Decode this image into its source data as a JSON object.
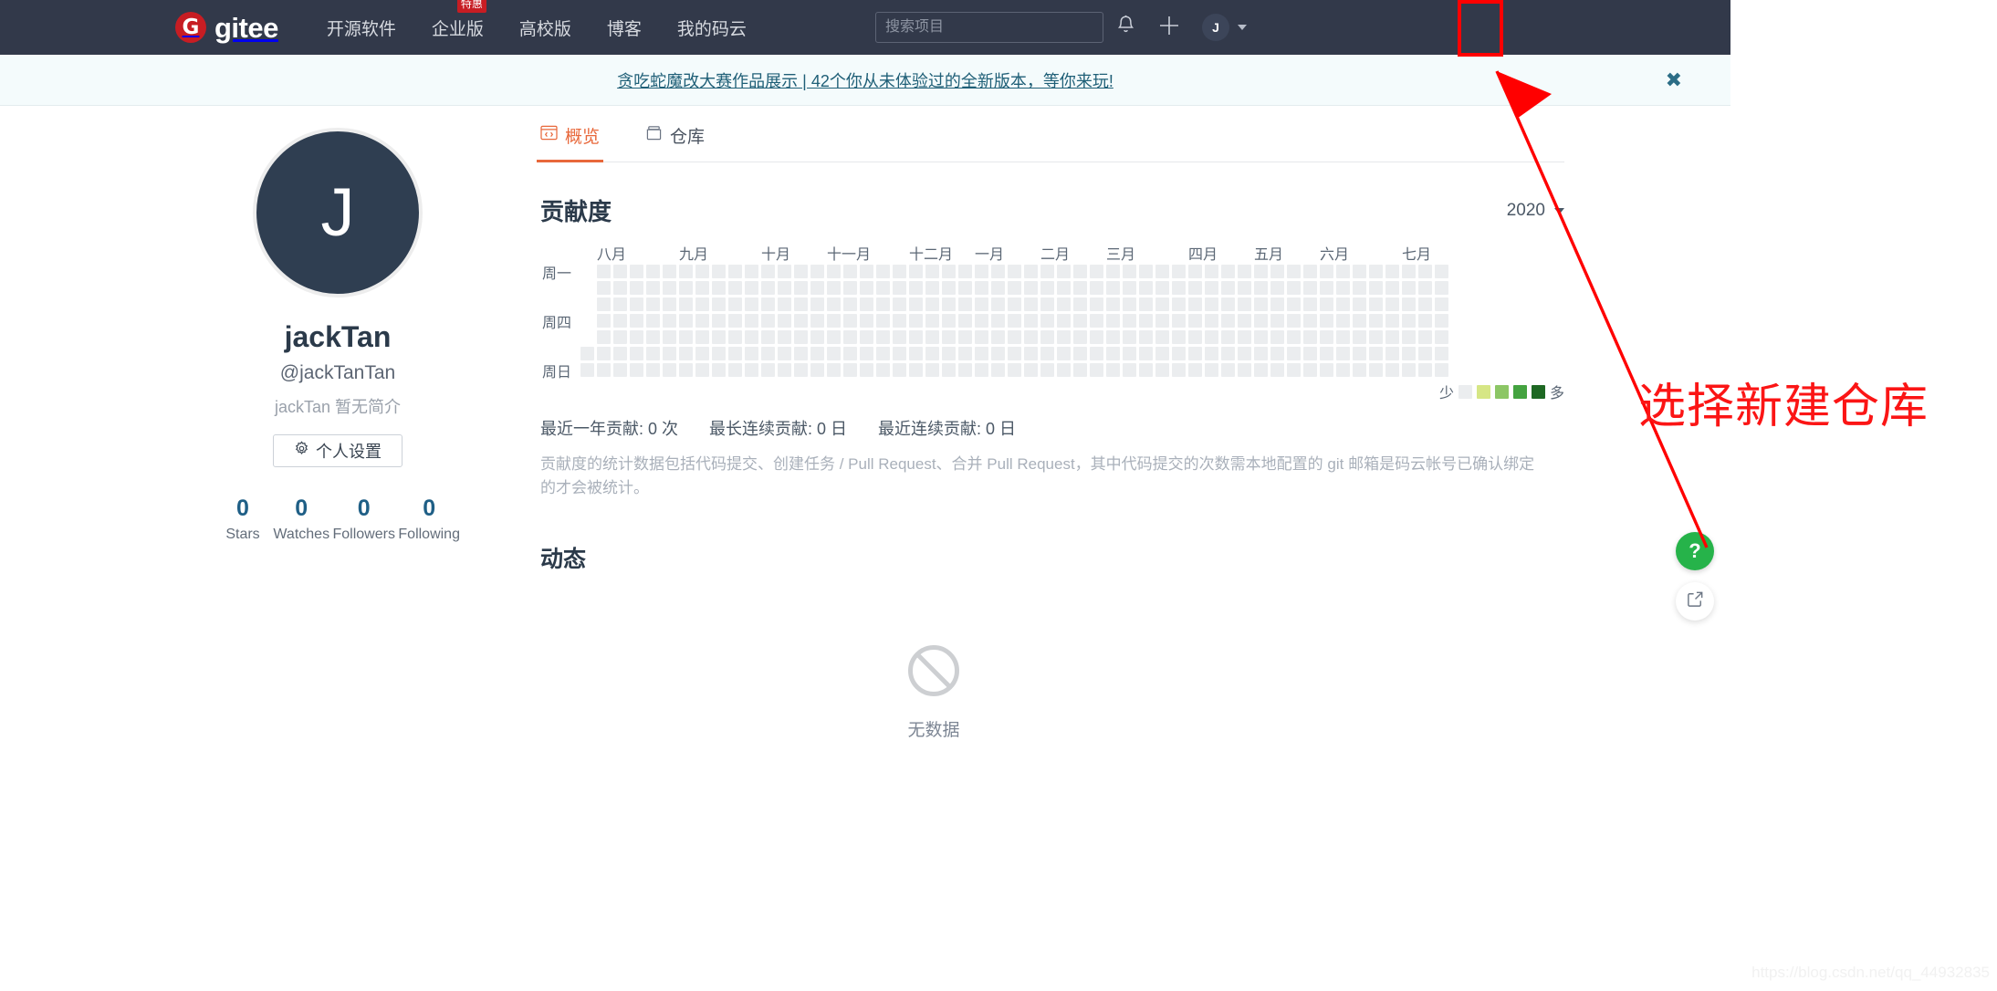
{
  "navbar": {
    "brand_mark": "G",
    "brand_text": "gitee",
    "menu": [
      {
        "label": "开源软件",
        "badge": null
      },
      {
        "label": "企业版",
        "badge": "特惠"
      },
      {
        "label": "高校版",
        "badge": null
      },
      {
        "label": "博客",
        "badge": null
      },
      {
        "label": "我的码云",
        "badge": null
      }
    ],
    "search_placeholder": "搜索项目",
    "search_value": "",
    "bell_icon": "bell-icon",
    "plus_icon": "plus-icon",
    "avatar_initial": "J",
    "bg_color": "#32394a"
  },
  "banner": {
    "text": "贪吃蛇魔改大赛作品展示 | 42个你从未体验过的全新版本，等你来玩!",
    "close_label": "✖",
    "bg_color": "#f4fbfc",
    "text_color": "#1f5f77"
  },
  "profile": {
    "avatar_initial": "J",
    "name": "jackTan",
    "login": "@jackTanTan",
    "bio": "jackTan 暂无简介",
    "settings_button": "个人设置",
    "settings_icon": "gear-icon",
    "stats": [
      {
        "value": "0",
        "label": "Stars"
      },
      {
        "value": "0",
        "label": "Watches"
      },
      {
        "value": "0",
        "label": "Followers"
      },
      {
        "value": "0",
        "label": "Following"
      }
    ]
  },
  "main": {
    "tabs": [
      {
        "label": "概览",
        "icon": "code-window-icon",
        "active": true
      },
      {
        "label": "仓库",
        "icon": "repo-icon",
        "active": false
      }
    ],
    "contribution": {
      "title": "贡献度",
      "year": "2020",
      "caret_icon": "chevron-down-icon",
      "weekday_labels": [
        "周一",
        "周四",
        "周日"
      ],
      "month_labels": [
        "八月",
        "九月",
        "十月",
        "十一月",
        "十二月",
        "一月",
        "二月",
        "三月",
        "四月",
        "五月",
        "六月",
        "七月"
      ],
      "legend_less": "少",
      "legend_more": "多",
      "legend_colors": [
        "#ebedef",
        "#d6e685",
        "#8cc665",
        "#44a340",
        "#1e6823"
      ],
      "stats": [
        "最近一年贡献: 0 次",
        "最长连续贡献: 0 日",
        "最近连续贡献: 0 日"
      ],
      "note": "贡献度的统计数据包括代码提交、创建任务 / Pull Request、合并 Pull Request，其中代码提交的次数需本地配置的 git 邮箱是码云帐号已确认绑定的才会被统计。"
    },
    "activity": {
      "title": "动态",
      "empty_icon": "no-data-icon",
      "empty_text": "无数据"
    }
  },
  "floating": {
    "help_label": "?",
    "help_icon": "question-mark-icon",
    "help_color": "#26b34a",
    "share_icon": "share-external-icon"
  },
  "annotation": {
    "text": "选择新建仓库",
    "color": "#fb1515",
    "highlight_target": "plus-icon"
  },
  "watermark": "https://blog.csdn.net/qq_44932835",
  "chart_data": {
    "type": "heatmap",
    "title": "贡献度",
    "xlabel": "",
    "ylabel": "",
    "categories": [
      "八月",
      "九月",
      "十月",
      "十一月",
      "十二月",
      "一月",
      "二月",
      "三月",
      "四月",
      "五月",
      "六月",
      "七月"
    ],
    "row_labels": [
      "周一",
      "",
      "",
      "周四",
      "",
      "",
      "周日"
    ],
    "weeks": 53,
    "days_per_week": 7,
    "values_all_zero": true,
    "total_contributions": 0,
    "longest_streak_days": 0,
    "current_streak_days": 0,
    "legend": {
      "less": "少",
      "more": "多",
      "colors": [
        "#ebedef",
        "#d6e685",
        "#8cc665",
        "#44a340",
        "#1e6823"
      ]
    }
  }
}
